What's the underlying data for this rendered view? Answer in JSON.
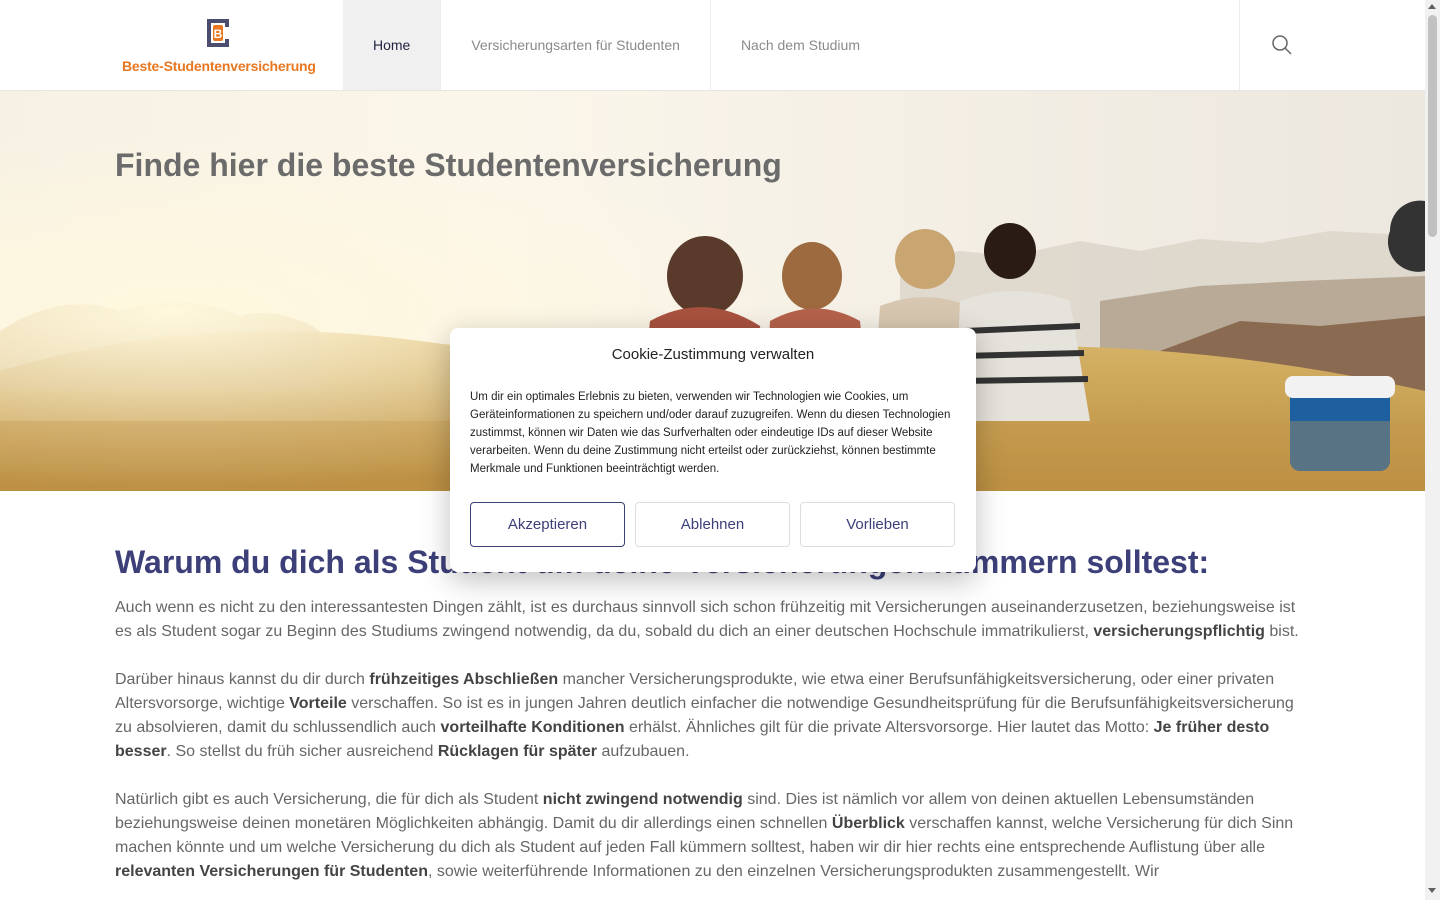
{
  "brand": {
    "name": "Beste-Studentenversicherung",
    "logo_letter": "B"
  },
  "nav": {
    "items": [
      {
        "label": "Home",
        "active": true
      },
      {
        "label": "Versicherungsarten für Studenten",
        "active": false
      },
      {
        "label": "Nach dem Studium",
        "active": false
      }
    ],
    "search_icon": "search-icon"
  },
  "hero": {
    "title": "Finde hier die beste Studentenversicherung"
  },
  "content": {
    "heading": "Warum du dich als Student um deine Versicherungen kümmern solltest:",
    "p1": [
      "Auch wenn es nicht zu den interessantesten Dingen zählt, ist es durchaus sinnvoll sich schon frühzeitig mit Versicherungen auseinanderzusetzen, beziehungsweise ist es als Student sogar zu Beginn des Studiums zwingend notwendig, da du, sobald du dich an einer deutschen Hochschule immatrikulierst, ",
      "versicherungspflichtig",
      " bist."
    ],
    "p2": [
      "Darüber hinaus kannst du dir durch ",
      "frühzeitiges Abschließen",
      " mancher Versicherungsprodukte, wie etwa einer Berufsunfähigkeitsversicherung, oder einer privaten Altersvorsorge, wichtige ",
      "Vorteile",
      " verschaffen. So ist es in jungen Jahren deutlich einfacher die notwendige Gesundheitsprüfung für die Berufsunfähigkeitsversicherung zu absolvieren, damit du schlussendlich auch ",
      "vorteilhafte Konditionen",
      " erhälst. Ähnliches gilt für die private Altersvorsorge. Hier lautet das Motto: ",
      "Je früher desto besser",
      ". So stellst du früh sicher ausreichend ",
      "Rücklagen für später",
      " aufzubauen."
    ],
    "p3": [
      "Natürlich gibt es auch Versicherung, die für dich als Student ",
      "nicht zwingend notwendig",
      " sind. Dies ist nämlich vor allem von deinen aktuellen Lebensumständen beziehungsweise deinen monetären Möglichkeiten abhängig. Damit du dir allerdings einen schnellen ",
      "Überblick",
      " verschaffen kannst, welche Versicherung für dich Sinn machen könnte und um welche Versicherung du dich als Student auf jeden Fall kümmern solltest, haben wir dir hier rechts eine entsprechende Auflistung über alle ",
      "relevanten Versicherungen für Studenten",
      ", sowie weiterführende Informationen zu den einzelnen Versicherungsprodukten zusammengestellt. Wir"
    ]
  },
  "cookie_modal": {
    "title": "Cookie-Zustimmung verwalten",
    "text": "Um dir ein optimales Erlebnis zu bieten, verwenden wir Technologien wie Cookies, um Geräteinformationen zu speichern und/oder darauf zuzugreifen. Wenn du diesen Technologien zustimmst, können wir Daten wie das Surfverhalten oder eindeutige IDs auf dieser Website verarbeiten. Wenn du deine Zustimmung nicht erteilst oder zurückziehst, können bestimmte Merkmale und Funktionen beeinträchtigt werden.",
    "accept_label": "Akzeptieren",
    "decline_label": "Ablehnen",
    "preferences_label": "Vorlieben"
  },
  "colors": {
    "accent": "#3c3f78",
    "brand_orange": "#e87722"
  }
}
